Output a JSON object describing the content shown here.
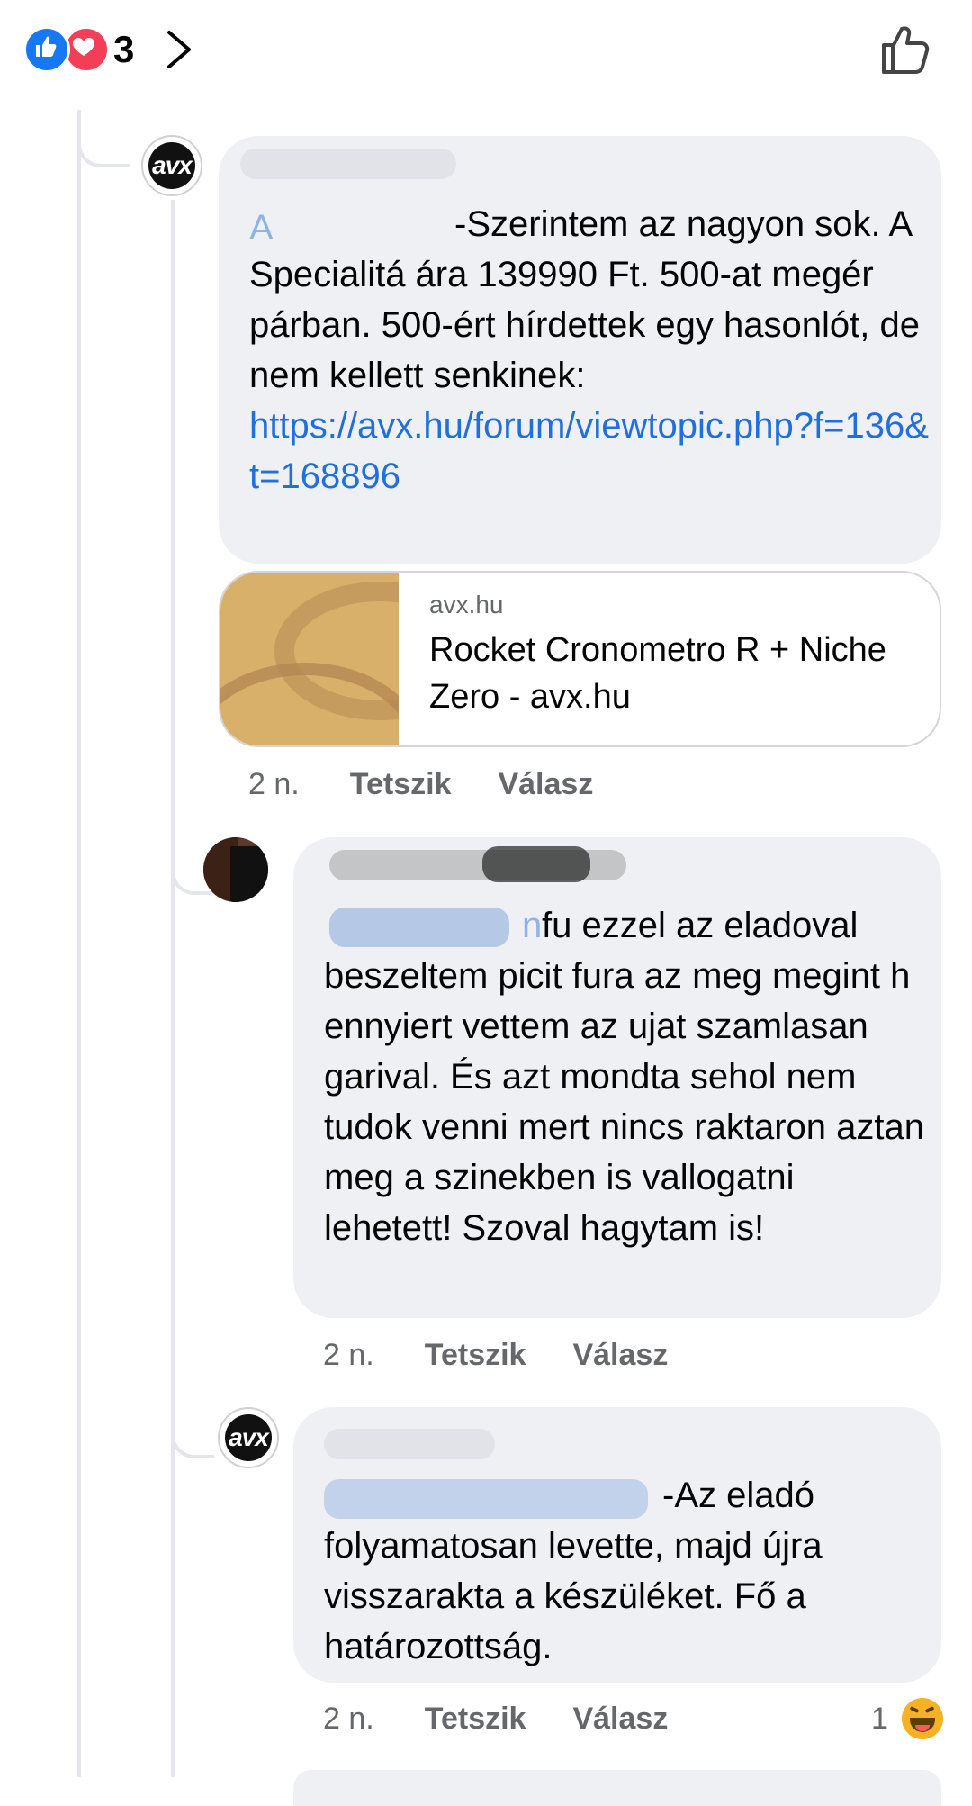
{
  "top_bar": {
    "reaction_count": "3",
    "reaction_icons": [
      "like-reaction-icon",
      "love-reaction-icon"
    ],
    "like_button_icon": "thumbs-up-outline-icon"
  },
  "comments": [
    {
      "avatar_text": "avx",
      "name_prefix_visible": "A",
      "text": "-Szerintem az nagyon sok. A Specialitá ára 139990 Ft. 500-at megér párban. 500-ért hírdettek egy hasonlót, de nem kellett senkinek:",
      "link_text": "https://avx.hu/forum/viewtopic.php?f=136&t=168896",
      "link_preview": {
        "domain": "avx.hu",
        "title": "Rocket Cronometro R + Niche Zero - avx.hu"
      },
      "time": "2 n.",
      "like_label": "Tetszik",
      "reply_label": "Válasz"
    },
    {
      "visible_fragment": "n",
      "text": "fu ezzel az eladoval beszeltem picit fura az meg megint h ennyiert vettem az ujat szamlasan garival. És azt mondta sehol nem tudok venni mert nincs raktaron aztan meg a szinekben is vallogatni lehetett! Szoval hagytam is!",
      "time": "2 n.",
      "like_label": "Tetszik",
      "reply_label": "Válasz"
    },
    {
      "avatar_text": "avx",
      "text": "-Az eladó folyamatosan levette, majd újra visszarakta a készüléket. Fő a határozottság.",
      "time": "2 n.",
      "like_label": "Tetszik",
      "reply_label": "Válasz",
      "reaction_count": "1",
      "reaction_icon": "haha-reaction-icon"
    }
  ],
  "colors": {
    "bubble": "#eff0f4",
    "link": "#216fdb",
    "meta_text": "#65676b",
    "like_blue": "#1877f2",
    "love_red": "#f33e58",
    "haha_yellow": "#f7b125"
  }
}
